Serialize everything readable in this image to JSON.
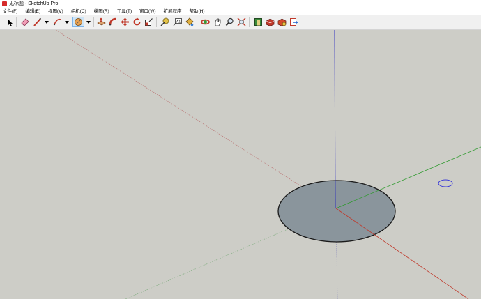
{
  "window": {
    "title": "无标题 - SketchUp Pro"
  },
  "menubar": {
    "items": [
      {
        "label": "文件(F)"
      },
      {
        "label": "编辑(E)"
      },
      {
        "label": "视图(V)"
      },
      {
        "label": "相机(C)"
      },
      {
        "label": "绘图(R)"
      },
      {
        "label": "工具(T)"
      },
      {
        "label": "窗口(W)"
      },
      {
        "label": "扩展程序"
      },
      {
        "label": "帮助(H)"
      }
    ]
  },
  "toolbar": {
    "tools": [
      {
        "name": "select-icon"
      },
      {
        "name": "eraser-icon"
      },
      {
        "name": "line-icon"
      },
      {
        "name": "arc-icon"
      },
      {
        "name": "shapes-icon",
        "active": true
      },
      {
        "name": "push-pull-icon"
      },
      {
        "name": "follow-me-icon"
      },
      {
        "name": "move-icon"
      },
      {
        "name": "rotate-icon"
      },
      {
        "name": "scale-icon"
      },
      {
        "name": "tape-measure-icon"
      },
      {
        "name": "text-icon"
      },
      {
        "name": "paint-bucket-icon"
      },
      {
        "name": "orbit-icon"
      },
      {
        "name": "pan-icon"
      },
      {
        "name": "zoom-icon"
      },
      {
        "name": "zoom-extents-icon"
      },
      {
        "name": "warehouse-icon"
      },
      {
        "name": "extension-warehouse-icon"
      },
      {
        "name": "extension-manager-icon"
      },
      {
        "name": "send-to-layout-icon"
      }
    ]
  },
  "scene": {
    "colors": {
      "background": "#cdcdc7",
      "axis_red": "#c0392b",
      "axis_green": "#2e9a2e",
      "axis_blue": "#2020c0",
      "face": "#8a959c",
      "edge": "#1a1a1a",
      "cursor_circle": "#3a3ad8"
    }
  }
}
